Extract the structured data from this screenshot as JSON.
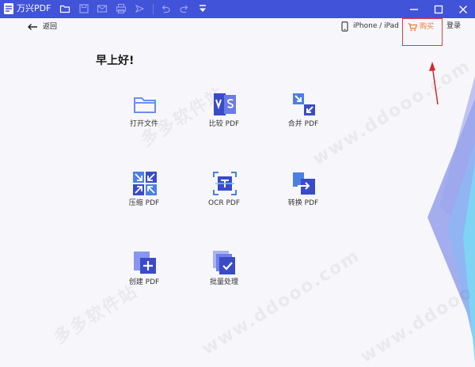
{
  "window": {
    "title": "万兴PDF"
  },
  "header": {
    "back_label": "返回",
    "device_label": "iPhone / iPad",
    "buy_label": "购买",
    "login_label": "登录"
  },
  "greeting": "早上好!",
  "tiles": [
    {
      "label": "打开文件",
      "icon": "folder-icon"
    },
    {
      "label": "比较 PDF",
      "icon": "compare-icon"
    },
    {
      "label": "合并 PDF",
      "icon": "merge-icon"
    },
    {
      "label": "压缩 PDF",
      "icon": "compress-icon"
    },
    {
      "label": "OCR PDF",
      "icon": "ocr-icon"
    },
    {
      "label": "转换 PDF",
      "icon": "convert-icon"
    },
    {
      "label": "创建 PDF",
      "icon": "create-icon"
    },
    {
      "label": "批量处理",
      "icon": "batch-icon"
    }
  ],
  "watermark": [
    "多多软件站",
    "www.ddooo.com"
  ],
  "colors": {
    "titlebar": "#4153d8",
    "accent": "#5b6cf0",
    "buy_text": "#f07a2a",
    "highlight_box": "#e23a3a"
  }
}
